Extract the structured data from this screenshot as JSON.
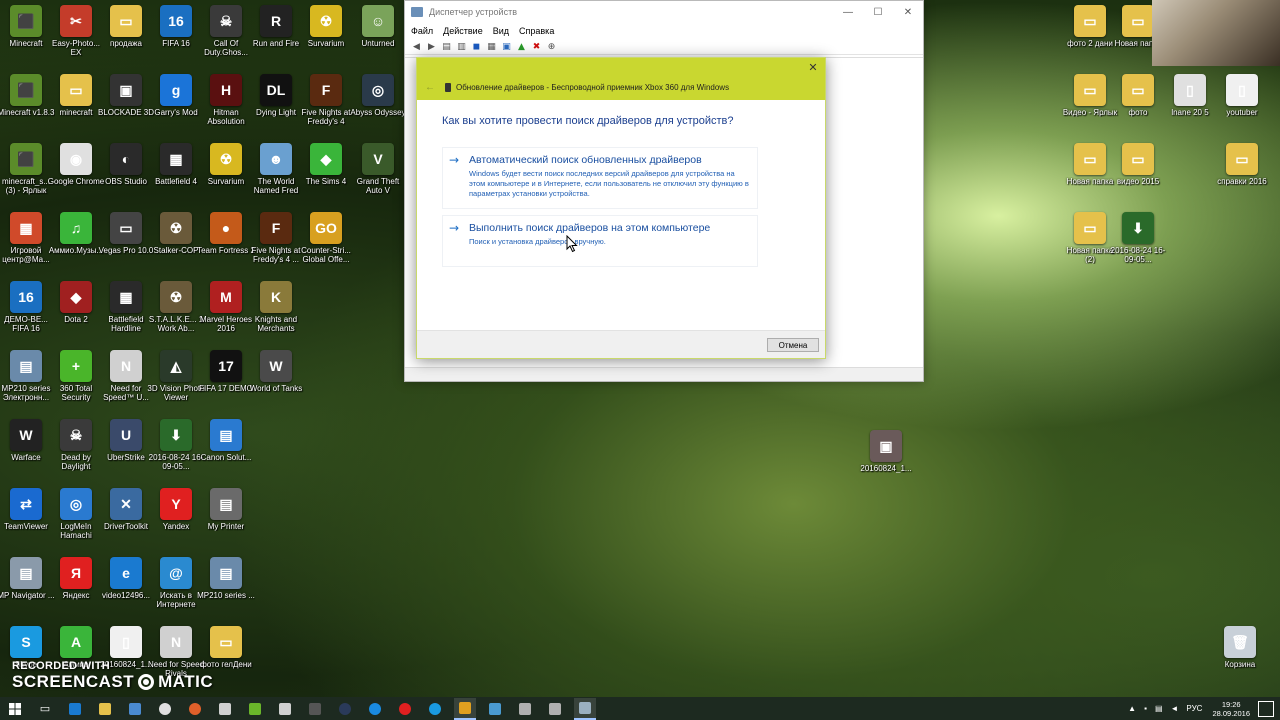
{
  "desktop_icons": [
    {
      "label": "Minecraft",
      "color": "#5b8c2a",
      "glyph": "⬛"
    },
    {
      "label": "Easy-Photo... EX",
      "color": "#c43c2a",
      "glyph": "✂"
    },
    {
      "label": "продажа",
      "color": "#e5c14b",
      "glyph": "▭"
    },
    {
      "label": "FIFA 16",
      "color": "#1a6fc1",
      "glyph": "16"
    },
    {
      "label": "Call Of Duty.Ghos...",
      "color": "#3a3a3a",
      "glyph": "☠"
    },
    {
      "label": "Run and Fire",
      "color": "#222222",
      "glyph": "R"
    },
    {
      "label": "Survarium",
      "color": "#d8b820",
      "glyph": "☢"
    },
    {
      "label": "Unturned",
      "color": "#7aa35a",
      "glyph": "☺"
    },
    {
      "label": "Minecraft v1.8.3",
      "color": "#5b8c2a",
      "glyph": "⬛"
    },
    {
      "label": "minecraft",
      "color": "#e5c14b",
      "glyph": "▭"
    },
    {
      "label": "BLOCKADE 3D",
      "color": "#333333",
      "glyph": "▣"
    },
    {
      "label": "Garry's Mod",
      "color": "#1b74d8",
      "glyph": "g"
    },
    {
      "label": "Hitman Absolution",
      "color": "#5a1010",
      "glyph": "H"
    },
    {
      "label": "Dying Light",
      "color": "#111111",
      "glyph": "DL"
    },
    {
      "label": "Five Nights at Freddy's 4",
      "color": "#5a2a10",
      "glyph": "F"
    },
    {
      "label": "Abyss Odyssey",
      "color": "#2a3a4a",
      "glyph": "◎"
    },
    {
      "label": "minecraft_s... (3) - Ярлык",
      "color": "#5b8c2a",
      "glyph": "⬛"
    },
    {
      "label": "Google Chrome",
      "color": "#e0e0e0",
      "glyph": "◉"
    },
    {
      "label": "OBS Studio",
      "color": "#2a2a2a",
      "glyph": "◐"
    },
    {
      "label": "Battlefield 4",
      "color": "#2a2a2a",
      "glyph": "▦"
    },
    {
      "label": "Survarium",
      "color": "#d8b820",
      "glyph": "☢"
    },
    {
      "label": "The World Named Fred",
      "color": "#6aa0d0",
      "glyph": "☻"
    },
    {
      "label": "The Sims 4",
      "color": "#3ab53a",
      "glyph": "◆"
    },
    {
      "label": "Grand Theft Auto V",
      "color": "#3a5a2a",
      "glyph": "V"
    },
    {
      "label": "Игровой центр@Ма...",
      "color": "#d04a2a",
      "glyph": "▦"
    },
    {
      "label": "Аммио.Музы...",
      "color": "#3ab53a",
      "glyph": "♫"
    },
    {
      "label": "Vegas Pro 10.0",
      "color": "#444444",
      "glyph": "▭"
    },
    {
      "label": "Stalker-COP",
      "color": "#6a5a3a",
      "glyph": "☢"
    },
    {
      "label": "Team Fortress 2",
      "color": "#c45a1a",
      "glyph": "●"
    },
    {
      "label": "Five Nights at Freddy's 4 ...",
      "color": "#5a2a10",
      "glyph": "F"
    },
    {
      "label": "Counter-Stri... Global Offe...",
      "color": "#d8a020",
      "glyph": "GO"
    },
    {
      "label": "ДЕМО-ВЕ... FIFA 16",
      "color": "#1a6fc1",
      "glyph": "16"
    },
    {
      "label": "Dota 2",
      "color": "#a02020",
      "glyph": "◆"
    },
    {
      "label": "Battlefield Hardline",
      "color": "#2a2a2a",
      "glyph": "▦"
    },
    {
      "label": "S.T.A.L.K.E... 1 Work Ab...",
      "color": "#6a5a3a",
      "glyph": "☢"
    },
    {
      "label": "Marvel Heroes 2016",
      "color": "#b02020",
      "glyph": "M"
    },
    {
      "label": "Knights and Merchants",
      "color": "#8a7a3a",
      "glyph": "K"
    },
    {
      "label": "MP210 series Электронн...",
      "color": "#6a8aaa",
      "glyph": "▤"
    },
    {
      "label": "360 Total Security",
      "color": "#4ab52a",
      "glyph": "+"
    },
    {
      "label": "Need for Speed™ U...",
      "color": "#d0d0d0",
      "glyph": "N"
    },
    {
      "label": "3D Vision Photo Viewer",
      "color": "#2a3a2a",
      "glyph": "◭"
    },
    {
      "label": "FIFA 17 DEMO",
      "color": "#111111",
      "glyph": "17"
    },
    {
      "label": "World of Tanks",
      "color": "#4a4a4a",
      "glyph": "W"
    },
    {
      "label": "Warface",
      "color": "#222222",
      "glyph": "W"
    },
    {
      "label": "Dead by Daylight",
      "color": "#3a3a3a",
      "glyph": "☠"
    },
    {
      "label": "UberStrike",
      "color": "#3a4a6a",
      "glyph": "U"
    },
    {
      "label": "2016-08-24 16-09-05...",
      "color": "#2a6a2a",
      "glyph": "⬇"
    },
    {
      "label": "Canon Solut...",
      "color": "#2a7ad0",
      "glyph": "▤"
    },
    {
      "label": "TeamViewer",
      "color": "#1a6ad0",
      "glyph": "⇄"
    },
    {
      "label": "LogMeIn Hamachi",
      "color": "#2a7ad0",
      "glyph": "◎"
    },
    {
      "label": "DriverToolkit",
      "color": "#3a6aa0",
      "glyph": "✕"
    },
    {
      "label": "Yandex",
      "color": "#e02020",
      "glyph": "Y"
    },
    {
      "label": "My Printer",
      "color": "#6a6a6a",
      "glyph": "▤"
    },
    {
      "label": "MP Navigator ...",
      "color": "#8a9aaa",
      "glyph": "▤"
    },
    {
      "label": "Яндекс",
      "color": "#e02020",
      "glyph": "Я"
    },
    {
      "label": "video12496...",
      "color": "#1a7ad0",
      "glyph": "e"
    },
    {
      "label": "Искать в Интернете",
      "color": "#2a8ad0",
      "glyph": "@"
    },
    {
      "label": "MP210 series ...",
      "color": "#6a8aaa",
      "glyph": "▤"
    },
    {
      "label": "Skype",
      "color": "#1a9ae0",
      "glyph": "S"
    },
    {
      "label": "Аммио",
      "color": "#3ab53a",
      "glyph": "A"
    },
    {
      "label": "20160824_1...",
      "color": "#f0f0f0",
      "glyph": "▯"
    },
    {
      "label": "Need for Speed Rivals",
      "color": "#d0d0d0",
      "glyph": "N"
    },
    {
      "label": "фото гелДени",
      "color": "#e5c14b",
      "glyph": "▭"
    },
    {
      "label": "фото 2 дани",
      "color": "#e5c14b",
      "glyph": "▭"
    },
    {
      "label": "Новая папка",
      "color": "#e5c14b",
      "glyph": "▭"
    },
    {
      "label": "Видео - Ярлык",
      "color": "#e5c14b",
      "glyph": "▭"
    },
    {
      "label": "фото",
      "color": "#e5c14b",
      "glyph": "▭"
    },
    {
      "label": "lnane 20 5",
      "color": "#e0e0e0",
      "glyph": "▯"
    },
    {
      "label": "youtuber",
      "color": "#f0f0f0",
      "glyph": "▯"
    },
    {
      "label": "Новая папка",
      "color": "#e5c14b",
      "glyph": "▭"
    },
    {
      "label": "видео 2015",
      "color": "#e5c14b",
      "glyph": "▭"
    },
    {
      "label": "справки 2016",
      "color": "#e5c14b",
      "glyph": "▭"
    },
    {
      "label": "Новая папка (2)",
      "color": "#e5c14b",
      "glyph": "▭"
    },
    {
      "label": "2016-08-24 16-09-05...",
      "color": "#2a6a2a",
      "glyph": "⬇"
    },
    {
      "label": "20160824_1...",
      "color": "#6a5a5a",
      "glyph": "▣"
    },
    {
      "label": "Корзина",
      "color": "#c8d0d8",
      "glyph": "🗑"
    }
  ],
  "device_manager": {
    "title": "Диспетчер устройств",
    "menu": [
      "Файл",
      "Действие",
      "Вид",
      "Справка"
    ],
    "window_controls": [
      "—",
      "☐",
      "✕"
    ]
  },
  "dialog": {
    "title": "Обновление драйверов - Беспроводной приемник Xbox 360 для Windows",
    "question": "Как вы хотите провести поиск драйверов для устройств?",
    "option_auto": {
      "title": "Автоматический поиск обновленных драйверов",
      "desc": "Windows будет вести поиск последних версий драйверов для устройства на этом компьютере и в Интернете, если пользователь не отключил эту функцию в параметрах установки устройства."
    },
    "option_manual": {
      "title": "Выполнить поиск драйверов на этом компьютере",
      "desc": "Поиск и установка драйверов вручную."
    },
    "cancel": "Отмена"
  },
  "watermark": {
    "line1": "RECORDED WITH",
    "line2a": "SCREENCAST",
    "line2b": "MATIC"
  },
  "taskbar": {
    "lang": "РУС",
    "time": "19:26",
    "date": "28.09.2016"
  }
}
